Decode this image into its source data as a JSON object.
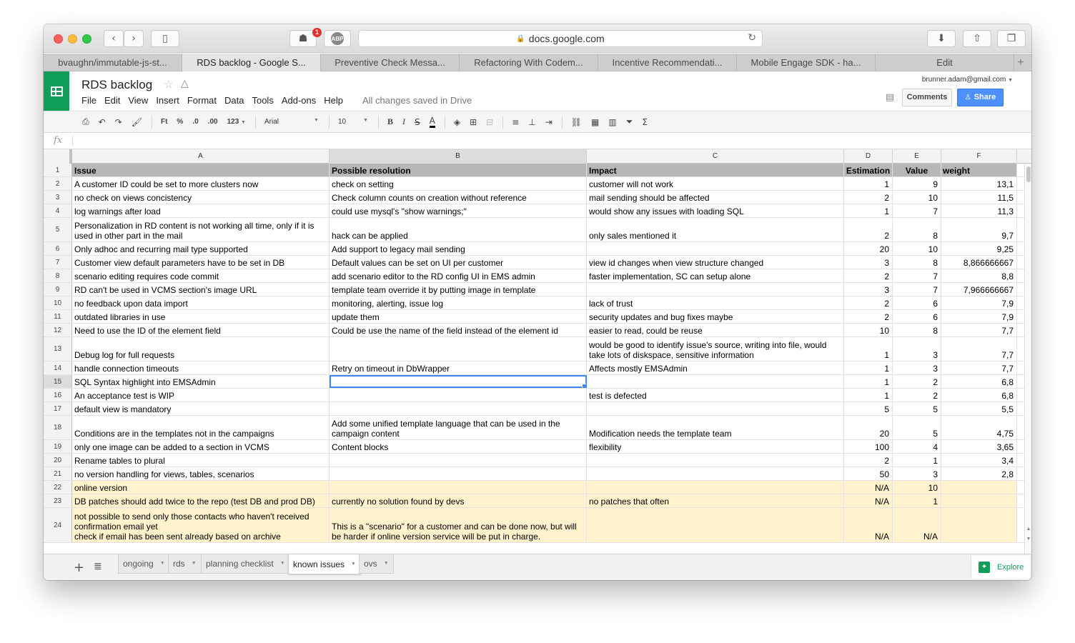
{
  "browser": {
    "url": "docs.google.com",
    "notification_count": "1",
    "adblock_label": "ABP",
    "tabs": [
      {
        "label": "bvaughn/immutable-js-st..."
      },
      {
        "label": "RDS backlog - Google S..."
      },
      {
        "label": "Preventive Check Messa..."
      },
      {
        "label": "Refactoring With Codem..."
      },
      {
        "label": "Incentive Recommendati..."
      },
      {
        "label": "Mobile Engage SDK - ha..."
      },
      {
        "label": "Edit"
      }
    ],
    "active_tab_index": 1
  },
  "sheets": {
    "title": "RDS backlog",
    "account": "brunner.adam@gmail.com",
    "save_status": "All changes saved in Drive",
    "menu": [
      "File",
      "Edit",
      "View",
      "Insert",
      "Format",
      "Data",
      "Tools",
      "Add-ons",
      "Help"
    ],
    "comments_label": "Comments",
    "share_label": "Share",
    "toolbar": {
      "format_ft": "Ft",
      "format_percent": "%",
      "decrease_decimal": ".0",
      "increase_decimal": ".00",
      "more_formats": "123",
      "font": "Arial",
      "font_size": "10",
      "bold": "B",
      "italic": "I",
      "strike": "S",
      "text_color": "A",
      "function": "Σ"
    },
    "formula_bar": {
      "fx": "fx",
      "value": ""
    }
  },
  "grid": {
    "columns": [
      "A",
      "B",
      "C",
      "D",
      "E",
      "F"
    ],
    "selected_column": "B",
    "selected_cell": {
      "row": 15,
      "col": "B"
    },
    "header_row": {
      "num": "1",
      "cells": [
        "Issue",
        "Possible resolution",
        "Impact",
        "Estimation",
        "Value",
        "Calculated weight"
      ]
    },
    "rows": [
      {
        "num": "2",
        "cells": [
          "A customer ID could be set to more clusters now",
          "check on setting",
          "customer will not work",
          "1",
          "9",
          "13,1"
        ]
      },
      {
        "num": "3",
        "cells": [
          "no check on views concistency",
          "Check column counts on creation without reference",
          "mail sending should be affected",
          "2",
          "10",
          "11,5"
        ]
      },
      {
        "num": "4",
        "cells": [
          "log warnings after load",
          "could use mysql's \"show warnings;\"",
          "would show any issues with loading SQL",
          "1",
          "7",
          "11,3"
        ]
      },
      {
        "num": "5",
        "cells": [
          "Personalization in RD content is not working all time, only if it is used in other part in the mail",
          "hack can be applied",
          "only sales mentioned it",
          "2",
          "8",
          "9,7"
        ]
      },
      {
        "num": "6",
        "cells": [
          "Only adhoc and recurring mail type supported",
          "Add support to legacy mail sending",
          "",
          "20",
          "10",
          "9,25"
        ]
      },
      {
        "num": "7",
        "cells": [
          "Customer view default parameters have to be set in DB",
          "Default values can be set on UI per customer",
          "view id changes when view structure changed",
          "3",
          "8",
          "8,866666667"
        ]
      },
      {
        "num": "8",
        "cells": [
          "scenario editing requires code commit",
          "add scenario editor to the RD config UI in EMS admin",
          "faster implementation, SC can setup alone",
          "2",
          "7",
          "8,8"
        ]
      },
      {
        "num": "9",
        "cells": [
          "RD can't be used in VCMS section's image URL",
          "template team override it by putting image in template",
          "",
          "3",
          "7",
          "7,966666667"
        ]
      },
      {
        "num": "10",
        "cells": [
          "no feedback upon data import",
          "monitoring, alerting, issue log",
          "lack of trust",
          "2",
          "6",
          "7,9"
        ]
      },
      {
        "num": "11",
        "cells": [
          "outdated libraries in use",
          "update them",
          "security updates and bug fixes maybe",
          "2",
          "6",
          "7,9"
        ]
      },
      {
        "num": "12",
        "cells": [
          "Need to use the ID of the element field",
          "Could be use the name of the field instead of the element id",
          "easier to read, could be reuse",
          "10",
          "8",
          "7,7"
        ]
      },
      {
        "num": "13",
        "cells": [
          "Debug log for full requests",
          "",
          "would be good to identify issue's source, writing into file, would take lots of diskspace, sensitive information",
          "1",
          "3",
          "7,7"
        ]
      },
      {
        "num": "14",
        "cells": [
          "handle connection timeouts",
          "Retry on timeout in DbWrapper",
          "Affects mostly EMSAdmin",
          "1",
          "3",
          "7,7"
        ]
      },
      {
        "num": "15",
        "cells": [
          "SQL Syntax highlight into EMSAdmin",
          "",
          "",
          "1",
          "2",
          "6,8"
        ]
      },
      {
        "num": "16",
        "cells": [
          "An acceptance test is WIP",
          "",
          "test is defected",
          "1",
          "2",
          "6,8"
        ]
      },
      {
        "num": "17",
        "cells": [
          "default view is mandatory",
          "",
          "",
          "5",
          "5",
          "5,5"
        ]
      },
      {
        "num": "18",
        "cells": [
          "Conditions are in the templates not in the campaigns",
          "Add some unified template language that can be used in the campaign content",
          "Modification needs the template team",
          "20",
          "5",
          "4,75"
        ]
      },
      {
        "num": "19",
        "cells": [
          "only one image can be added to a section in VCMS",
          "Content blocks",
          "flexibility",
          "100",
          "4",
          "3,65"
        ]
      },
      {
        "num": "20",
        "cells": [
          "Rename tables to plural",
          "",
          "",
          "2",
          "1",
          "3,4"
        ]
      },
      {
        "num": "21",
        "cells": [
          "no version handling for views, tables, scenarios",
          "",
          "",
          "50",
          "3",
          "2,8"
        ]
      },
      {
        "num": "22",
        "cells": [
          "online version",
          "",
          "",
          "N/A",
          "10",
          ""
        ]
      },
      {
        "num": "23",
        "cells": [
          "DB patches should add twice to the repo (test DB and prod DB)",
          "currently no solution found by devs",
          "no patches that often",
          "N/A",
          "1",
          ""
        ]
      },
      {
        "num": "24",
        "cells": [
          "not possible to send only those contacts who haven't received confirmation email yet\ncheck if email has been sent already based on archive",
          "This is a \"scenario\" for a customer and can be done now, but will be harder if online version service will be put in charge.",
          "",
          "N/A",
          "N/A",
          ""
        ]
      }
    ],
    "highlight_color": "#fff2cc",
    "header_color": "#b7b7b7"
  },
  "sheet_tabs": [
    {
      "label": "ongoing"
    },
    {
      "label": "rds"
    },
    {
      "label": "planning checklist"
    },
    {
      "label": "known issues"
    },
    {
      "label": "ovs"
    }
  ],
  "active_sheet": "known issues",
  "explore_label": "Explore"
}
